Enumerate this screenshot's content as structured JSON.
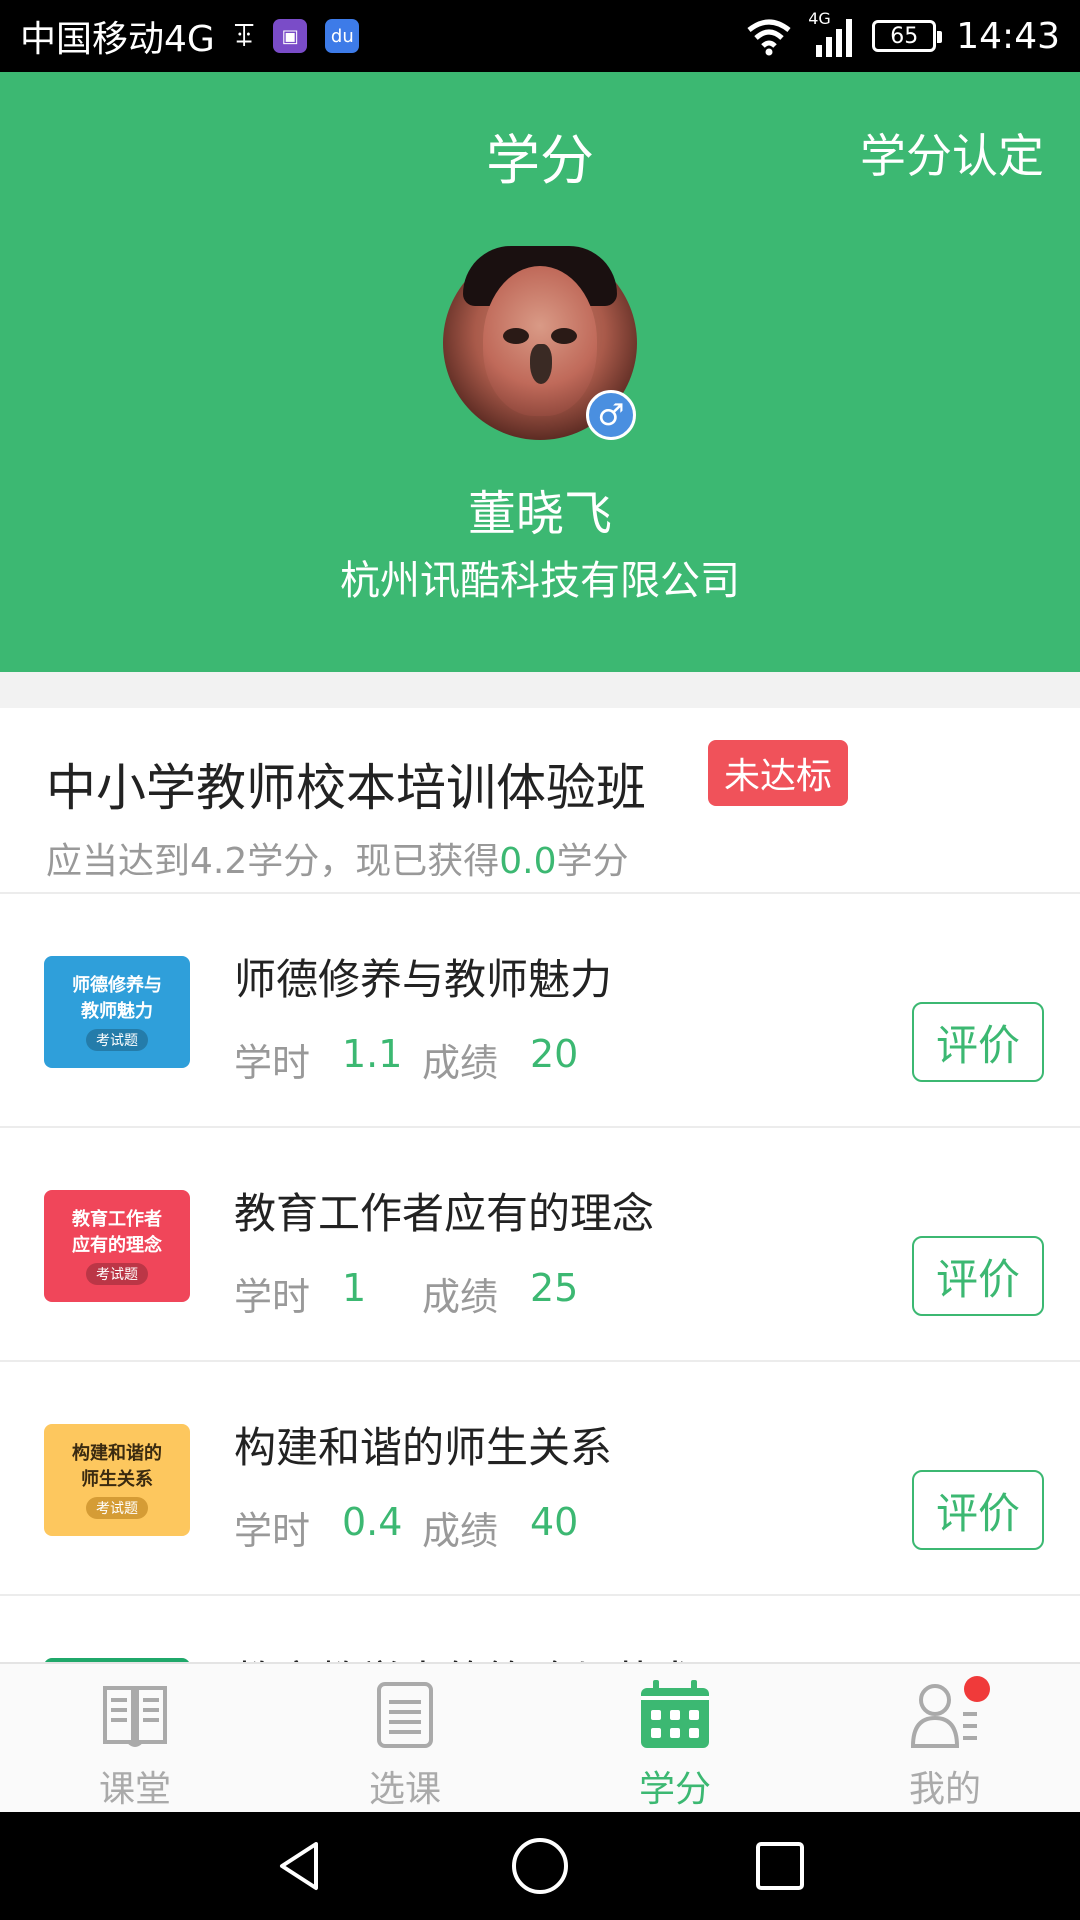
{
  "status_bar": {
    "carrier": "中国移动4G",
    "network": "4G",
    "battery": "65",
    "time": "14:43"
  },
  "header": {
    "title": "学分",
    "action_label": "学分认定",
    "user": {
      "gender_symbol": "♂",
      "name": "董晓飞",
      "company": "杭州讯酷科技有限公司"
    }
  },
  "class_info": {
    "title": "中小学教师校本培训体验班",
    "badge": "未达标",
    "sub_prefix": "应当达到4.2学分，现已获得",
    "earned": "0.0",
    "sub_suffix": "学分"
  },
  "courses": [
    {
      "title": "师德修养与教师魅力",
      "thumb_lines": [
        "师德修养与",
        "教师魅力"
      ],
      "thumb_tag": "考试题",
      "thumb_color": "#2f9fda",
      "hours_label": "学时",
      "hours": "1.1",
      "score_label": "成绩",
      "score": "20",
      "action": "评价"
    },
    {
      "title": "教育工作者应有的理念",
      "thumb_lines": [
        "教育工作者",
        "应有的理念"
      ],
      "thumb_tag": "考试题",
      "thumb_color": "#f0465a",
      "hours_label": "学时",
      "hours": "1",
      "score_label": "成绩",
      "score": "25",
      "action": "评价"
    },
    {
      "title": "构建和谐的师生关系",
      "thumb_lines": [
        "构建和谐的",
        "师生关系"
      ],
      "thumb_tag": "考试题",
      "thumb_color": "#fdc75e",
      "hours_label": "学时",
      "hours": "0.4",
      "score_label": "成绩",
      "score": "40",
      "action": "评价"
    },
    {
      "title": "教育教学中的策略与艺术",
      "thumb_lines": [
        "",
        ""
      ],
      "thumb_tag": "",
      "thumb_color": "#1fa86a",
      "hours_label": "",
      "hours": "",
      "score_label": "",
      "score": "",
      "action": ""
    }
  ],
  "tabbar": {
    "tabs": [
      {
        "label": "课堂",
        "icon": "book-icon"
      },
      {
        "label": "选课",
        "icon": "document-icon"
      },
      {
        "label": "学分",
        "icon": "calendar-grid-icon",
        "active": true
      },
      {
        "label": "我的",
        "icon": "person-list-icon",
        "badge": true
      }
    ]
  },
  "colors": {
    "primary": "#3cb872",
    "badge_red": "#f0525a",
    "muted": "#999999"
  }
}
